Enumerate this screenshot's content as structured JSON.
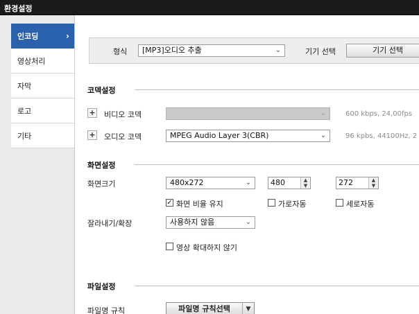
{
  "window": {
    "title": "환경설정"
  },
  "sidebar": {
    "items": [
      {
        "label": "인코딩",
        "active": true
      },
      {
        "label": "영상처리"
      },
      {
        "label": "자막"
      },
      {
        "label": "로고"
      },
      {
        "label": "기타"
      }
    ]
  },
  "format": {
    "label": "형식",
    "value": "[MP3]오디오 추출",
    "device_label": "기기 선택",
    "device_button": "기기 선택"
  },
  "codec": {
    "section_title": "코덱설정",
    "video": {
      "label": "비디오 코덱",
      "value": "",
      "info": "600 kbps, 24,00fps"
    },
    "audio": {
      "label": "오디오 코덱",
      "value": "MPEG Audio Layer 3(CBR)",
      "info": "96 kpbs, 44100Hz, 2"
    }
  },
  "screen": {
    "section_title": "화면설정",
    "size_label": "화면크기",
    "size_value": "480x272",
    "width": "480",
    "height": "272",
    "keep_ratio_label": "화면 비율 유지",
    "keep_ratio_checked": true,
    "auto_width_label": "가로자동",
    "auto_width_checked": false,
    "auto_height_label": "세로자동",
    "auto_height_checked": false,
    "crop_label": "잘라내기/확장",
    "crop_value": "사용하지 않음",
    "no_upscale_label": "영상 확대하지 않기",
    "no_upscale_checked": false
  },
  "file": {
    "section_title": "파일설정",
    "rule_label": "파일명 규칙",
    "rule_button": "파일명 규칙선택"
  },
  "icons": {
    "plus": "+",
    "check": "✓",
    "chevron_right": "›",
    "chevron_down": "⌄",
    "up": "▲",
    "down": "▼",
    "drop": "▼"
  },
  "colors": {
    "accent": "#2a61ad",
    "titlebar": "#1b1b1b"
  }
}
